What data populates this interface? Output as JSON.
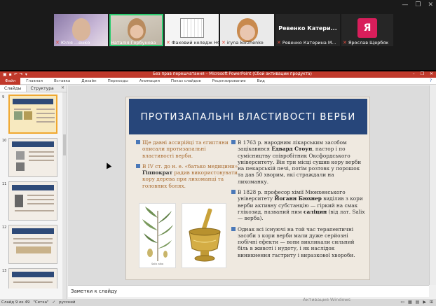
{
  "zoom": {
    "participants": [
      {
        "name": "Юлія ...енко",
        "muted": true
      },
      {
        "name": "Наталія Горбунова",
        "muted": false,
        "active": true
      },
      {
        "name": "Фаховий коледж НФ...",
        "muted": true
      },
      {
        "name": "iryna korzhenko",
        "muted": true
      },
      {
        "display": "Ревенко Катери...",
        "name": "Ревенко Катерина М...",
        "muted": true
      },
      {
        "display": "Я",
        "name": "Ярослав Щербяк",
        "muted": true
      }
    ]
  },
  "ppt": {
    "title": "Без прав перешчатання – Microsoft PowerPoint (Сбой активации продукта)",
    "tabs": [
      "Файл",
      "Главная",
      "Вставка",
      "Дизайн",
      "Переходы",
      "Анимация",
      "Показ слайдов",
      "Рецензирование",
      "Вид"
    ],
    "pane_tabs": [
      "Слайды",
      "Структура"
    ],
    "thumb_numbers": [
      "9",
      "10",
      "11",
      "12",
      "13"
    ],
    "notes_placeholder": "Заметки к слайду",
    "status": {
      "slide": "Слайд 9 из 49",
      "theme": "\"Сетка\"",
      "language": "русский"
    },
    "activation": "Активация Windows"
  },
  "slide": {
    "title": "ПРОТИЗАПАЛЬНІ ВЛАСТИВОСТІ ВЕРБИ",
    "left_bullets": [
      {
        "text": "Ще давні ассирійці та єгиптяни описали протизапальні властивості верби."
      },
      {
        "pre": "В IV ст. до н. е. «батько медицини» ",
        "bold": "Гіппократ",
        "post": " радив використовувати кору дерева при лихоманці та головних болях."
      }
    ],
    "right_bullets": [
      {
        "pre": "В 1763 р. народним лікарським засобом зацікавився ",
        "bold": "Едвард Стоун",
        "post": ", пастор і по сумісництву співробітник Оксфордського університету. Він три місці сушив кору верби на пекарській печі, потім розтовк у порошок та дав 50 хворим, які страждали на лихоманку."
      },
      {
        "pre": "В 1828 р. професор хімії Мюнхенського університету ",
        "bold": "Йоганн Бюхнер",
        "mid": " виділив з кори верби активну субстанцію — гіркий на смак глікозид, названий ним ",
        "bold2": "саліцин",
        "post": " (від лат. Salix — верба)."
      },
      {
        "text": "Однак всі існуючі на той час терапевтичні засоби з кори верби мали дуже серйозні побічні ефекти — вони викликали сильний біль в животі і нудоту, і як наслідок виникнення гастриту і виразкової хвороби."
      }
    ],
    "leaf_caption": "Salix alba"
  }
}
